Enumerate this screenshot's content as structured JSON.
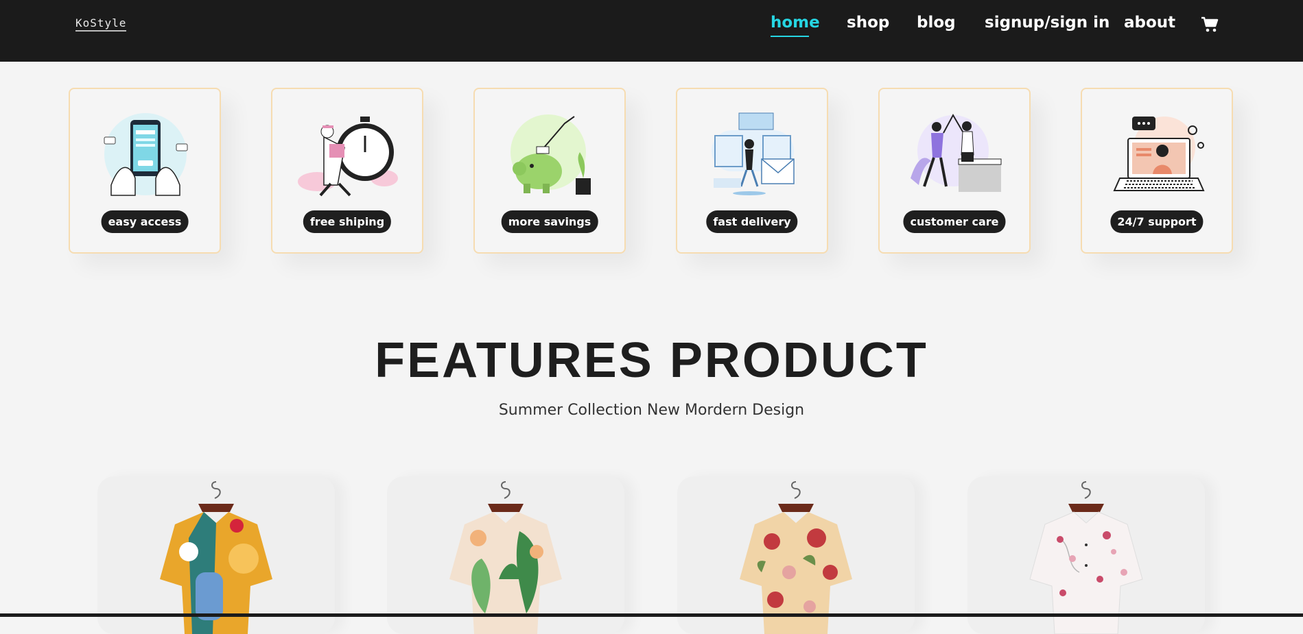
{
  "header": {
    "logo": "KoStyle",
    "nav": [
      {
        "label": "home",
        "active": true
      },
      {
        "label": "shop",
        "active": false
      },
      {
        "label": "blog",
        "active": false
      },
      {
        "label": "signup/sign in",
        "active": false
      },
      {
        "label": "about",
        "active": false
      }
    ],
    "cart_icon": "cart-icon"
  },
  "features": [
    {
      "label": "easy access",
      "icon": "payment-phone-illustration"
    },
    {
      "label": "free shiping",
      "icon": "stopwatch-courier-illustration"
    },
    {
      "label": "more savings",
      "icon": "piggy-bank-illustration"
    },
    {
      "label": "fast delivery",
      "icon": "gift-delivery-illustration"
    },
    {
      "label": "customer care",
      "icon": "high-five-illustration"
    },
    {
      "label": "24/7 support",
      "icon": "laptop-support-illustration"
    }
  ],
  "section": {
    "title": "FEATURES PRODUCT",
    "subtitle": "Summer Collection New Mordern Design"
  },
  "products": [
    {
      "image": "abstract-pattern-shirt",
      "colors": [
        "#e9a62b",
        "#2e7d7a",
        "#f7c35a",
        "#6b9bd1"
      ]
    },
    {
      "image": "green-leaf-floral-shirt",
      "colors": [
        "#f3e1cf",
        "#3f8a4a",
        "#6fb36a",
        "#f2b27a"
      ]
    },
    {
      "image": "red-floral-shirt",
      "colors": [
        "#f1d4a7",
        "#c23a3f",
        "#6a8f4a",
        "#e5a3a0"
      ]
    },
    {
      "image": "pink-blossom-white-shirt",
      "colors": [
        "#f7f2f2",
        "#c94b6a",
        "#e7a4b5",
        "#b8b8b8"
      ]
    }
  ]
}
